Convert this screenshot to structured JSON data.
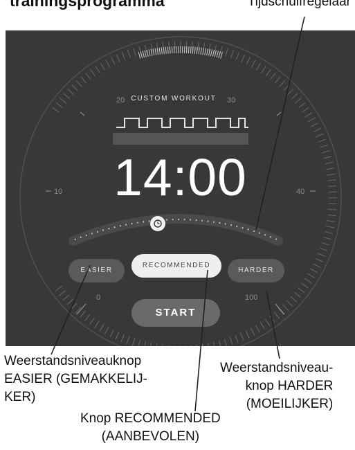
{
  "heading": "trainingsprogramma",
  "callouts": {
    "slider": "Tijdschuifregelaar",
    "easier": [
      "Weerstandsniveauknop",
      "EASIER (GEMAKKELIJ-",
      "KER)"
    ],
    "harder": [
      "Weerstandsniveau-",
      "knop HARDER",
      "(MOEILIJKER)"
    ],
    "recommended": [
      "Knop RECOMMENDED",
      "(AANBEVOLEN)"
    ]
  },
  "screen": {
    "workout_title": "CUSTOM WORKOUT",
    "timer": "14:00",
    "dial_labels": {
      "n20": "20",
      "n30": "30",
      "n10": "10",
      "n40": "40",
      "n0": "0",
      "n100": "100"
    },
    "buttons": {
      "easier": "EASIER",
      "recommended": "RECOMMENDED",
      "harder": "HARDER",
      "start": "START"
    },
    "slider_icon": "clock-icon"
  }
}
